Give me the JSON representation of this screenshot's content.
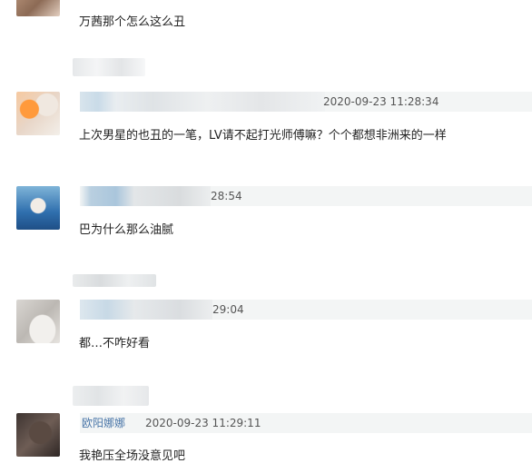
{
  "comments": [
    {
      "text": "万茜那个怎么这么丑"
    },
    {
      "timestamp": "2020-09-23 11:28:34",
      "text": "上次男星的也丑的一笔，LV请不起打光师傅嘛？个个都想非洲来的一样"
    },
    {
      "timestamp": "28:54",
      "text": "巴为什么那么油腻"
    },
    {
      "timestamp": "29:04",
      "text": "都…不咋好看"
    },
    {
      "username": "欧阳娜娜",
      "timestamp": "2020-09-23 11:29:11",
      "text": "我艳压全场没意见吧"
    }
  ],
  "colors": {
    "meta_bar": "#f3f5f5",
    "username": "#4a76a8",
    "text": "#222222"
  }
}
